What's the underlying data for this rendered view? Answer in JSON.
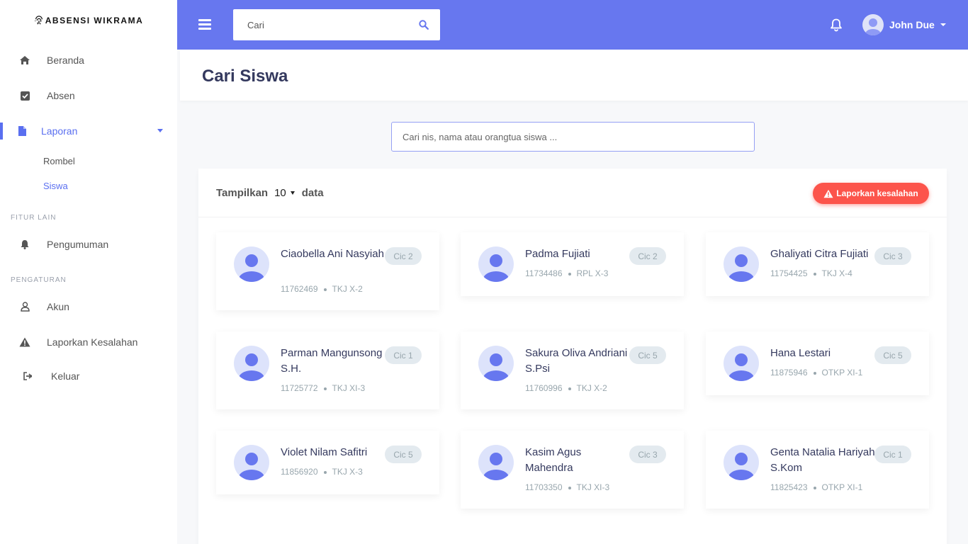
{
  "brand": {
    "name": "ABSENSI WIKRAMA"
  },
  "sidebar": {
    "items": [
      {
        "label": "Beranda",
        "icon": "home-icon"
      },
      {
        "label": "Absen",
        "icon": "check-square-icon"
      },
      {
        "label": "Laporan",
        "icon": "file-icon",
        "active": true
      },
      {
        "label": "Pengumuman",
        "icon": "bell-icon"
      },
      {
        "label": "Akun",
        "icon": "user-icon"
      },
      {
        "label": "Laporkan Kesalahan",
        "icon": "warning-icon"
      },
      {
        "label": "Keluar",
        "icon": "sign-out-icon"
      }
    ],
    "sub_items": [
      {
        "label": "Rombel"
      },
      {
        "label": "Siswa",
        "active": true
      }
    ],
    "sections": [
      "FITUR LAIN",
      "PENGATURAN"
    ]
  },
  "topbar": {
    "search_placeholder": "Cari",
    "user_name": "John Due"
  },
  "page": {
    "title": "Cari Siswa",
    "search_placeholder": "Cari nis, nama atau orangtua siswa ...",
    "show_label": "Tampilkan",
    "show_value": "10",
    "show_suffix": "data",
    "report_button": "Laporkan kesalahan"
  },
  "students": [
    {
      "name": "Ciaobella Ani Nasyiah",
      "nis": "11762469",
      "rombel": "TKJ X-2",
      "rayon": "Cic 2"
    },
    {
      "name": "Padma Fujiati",
      "nis": "11734486",
      "rombel": "RPL X-3",
      "rayon": "Cic 2"
    },
    {
      "name": "Ghaliyati Citra Fujiati",
      "nis": "11754425",
      "rombel": "TKJ X-4",
      "rayon": "Cic 3"
    },
    {
      "name": "Parman Mangunsong S.H.",
      "nis": "11725772",
      "rombel": "TKJ XI-3",
      "rayon": "Cic 1"
    },
    {
      "name": "Sakura Oliva Andriani S.Psi",
      "nis": "11760996",
      "rombel": "TKJ X-2",
      "rayon": "Cic 5"
    },
    {
      "name": "Hana Lestari",
      "nis": "11875946",
      "rombel": "OTKP XI-1",
      "rayon": "Cic 5"
    },
    {
      "name": "Violet Nilam Safitri",
      "nis": "11856920",
      "rombel": "TKJ X-3",
      "rayon": "Cic 5"
    },
    {
      "name": "Kasim Agus Mahendra",
      "nis": "11703350",
      "rombel": "TKJ XI-3",
      "rayon": "Cic 3"
    },
    {
      "name": "Genta Natalia Hariyah S.Kom",
      "nis": "11825423",
      "rombel": "OTKP XI-1",
      "rayon": "Cic 1"
    }
  ],
  "colors": {
    "primary": "#6777ef",
    "danger": "#fc544b",
    "badge_bg": "#e3eaef"
  }
}
